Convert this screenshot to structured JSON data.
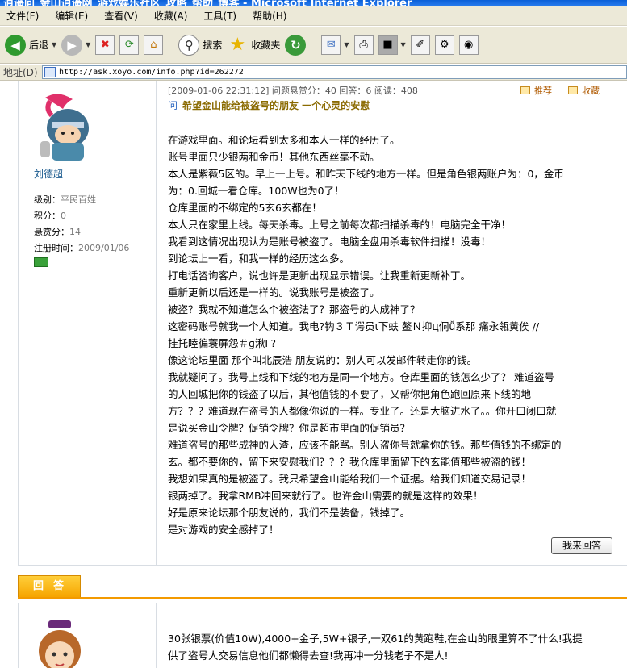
{
  "window": {
    "title": "逍遥问_金山逍遥网_游戏娱乐社区_攻略_帮助_博客 - Microsoft Internet Explorer"
  },
  "menu": [
    "文件(F)",
    "编辑(E)",
    "查看(V)",
    "收藏(A)",
    "工具(T)",
    "帮助(H)"
  ],
  "toolbar": {
    "back": "后退",
    "search": "搜索",
    "favorites": "收藏夹"
  },
  "address": {
    "label": "地址(D)",
    "url": "http://ask.xoyo.com/info.php?id=262272"
  },
  "post": {
    "meta": "[2009-01-06 22:31:12]  问题悬赏分：40   回答：6  阅读：408",
    "recommend": "推荐",
    "collect": "收藏",
    "q_mark": "问",
    "title": "希望金山能给被盗号的朋友  一个心灵的安慰",
    "user": {
      "name": "刘德超",
      "level_label": "级别：",
      "level": "平民百姓",
      "points_label": "积分：",
      "points": "0",
      "bounty_label": "悬赏分：",
      "bounty": "14",
      "reg_label": "注册时间：",
      "reg": "2009/01/06"
    },
    "lines": [
      "在游戏里面。和论坛看到太多和本人一样的经历了。",
      "账号里面只少银两和金币！其他东西丝毫不动。",
      "本人是紫薇5区的。早上一上号。和昨天下线的地方一样。但是角色银两账户为：0，金币",
      "为：0.回城一看仓库。100W也为0了！",
      "仓库里面的不绑定的5玄6玄都在！",
      "本人只在家里上线。每天杀毒。上号之前每次都扫描杀毒的！电脑完全干净！",
      "我看到这情况出现认为是账号被盗了。电脑全盘用杀毒软件扫描！没毒！",
      "到论坛上一看，和我一样的经历这么多。",
      "打电话咨询客户，说也许是更新出现显示错误。让我重新更新补丁。",
      "重新更新以后还是一样的。说我账号是被盗了。",
      "被盗？我就不知道怎么个被盗法了？那盗号的人成神了？",
      "这密码账号就我一个人知道。我电?钩３Ｔ谔员ι下蚨    鳌Ｎ抑ц侗ǚ系那    痛永瓴黄俟    //",
      "挂托睦徧蓑屏怨＃ɡ湫Γ?",
      "像这论坛里面 那个叫北辰浩 朋友说的：别人可以发邮件转走你的钱。",
      "我就疑问了。我号上线和下线的地方是同一个地方。仓库里面的钱怎么少了？  难道盗号",
      "的人回城把你的钱盗了以后，其他值钱的不要了，又帮你把角色跑回原来下线的地",
      "方？？？难道现在盗号的人都像你说的一样。专业了。还是大脑进水了。。你开口闭口就",
      "是说买金山令牌？促销令牌？你是超市里面的促销员？",
      "难道盗号的那些成神的人渣，应该不能骂。别人盗你号就拿你的钱。那些值钱的不绑定的",
      "玄。都不要你的，留下来安慰我们？？？我仓库里面留下的玄能值那些被盗的钱！",
      "我想如果真的是被盗了。我只希望金山能给我们一个证据。给我们知道交易记录！",
      "银两掉了。我拿RMB冲回来就行了。也许金山需要的就是这样的效果！",
      "好是原来论坛那个朋友说的，我们不是装备，钱掉了。",
      "是对游戏的安全感掉了！"
    ],
    "reply_button": "我来回答"
  },
  "answers": {
    "tab_label": "回答",
    "first": {
      "lines": [
        "30张银票(价值10W),4000+金子,5W+银子,一双61的黄跑鞋,在金山的眼里算不了什么!我提",
        "供了盗号人交易信息他们都懒得去查!我再冲一分钱老子不是人!"
      ]
    }
  }
}
